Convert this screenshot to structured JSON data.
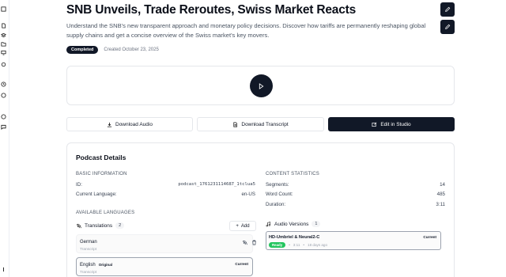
{
  "rail": {
    "icons": [
      "panel-icon",
      "file-icon",
      "layers-icon",
      "folder-icon",
      "monitor-icon",
      "settings-icon",
      "clock-icon",
      "users-icon",
      "help-icon",
      "chat-icon",
      "info-icon"
    ]
  },
  "header": {
    "title": "SNB Unveils, Trade Reroutes, Swiss Market Reacts",
    "description": "Understand the SNB's new transparent approach and monetary policy decisions. Discover how tariffs are permanently reshaping global supply chains and get a concise overview of the Swiss market's key movers.",
    "status_badge": "Completed",
    "created": "Created October 23, 2025"
  },
  "actions": {
    "download_audio": "Download Audio",
    "download_transcript": "Download Transcript",
    "edit_in_studio": "Edit in Studio"
  },
  "details": {
    "title": "Podcast Details",
    "basic_info_heading": "BASIC INFORMATION",
    "id_label": "ID:",
    "id_value": "podcast_1761231114687_1tclua5",
    "language_label": "Current Language:",
    "language_value": "en-US",
    "stats_heading": "CONTENT STATISTICS",
    "segments_label": "Segments:",
    "segments_value": "14",
    "wordcount_label": "Word Count:",
    "wordcount_value": "485",
    "duration_label": "Duration:",
    "duration_value": "3:11",
    "languages_heading": "AVAILABLE LANGUAGES",
    "translations_label": "Translations",
    "translations_count": "2",
    "add_label": "Add",
    "audio_versions_label": "Audio Versions",
    "audio_versions_count": "1"
  },
  "languages": [
    {
      "name": "German",
      "type": "Transcript"
    },
    {
      "name": "English",
      "tag": "Original",
      "type": "Transcript",
      "current": "Current"
    }
  ],
  "audio_version": {
    "name": "HD-Umbriel & Neural2-C",
    "current": "Current",
    "status": "Ready",
    "duration": "3:11",
    "age": "18 days ago"
  },
  "colors": {
    "primary": "#111827",
    "border": "#e5e7eb",
    "ready": "#22c55e",
    "muted_text": "#6b7280"
  }
}
